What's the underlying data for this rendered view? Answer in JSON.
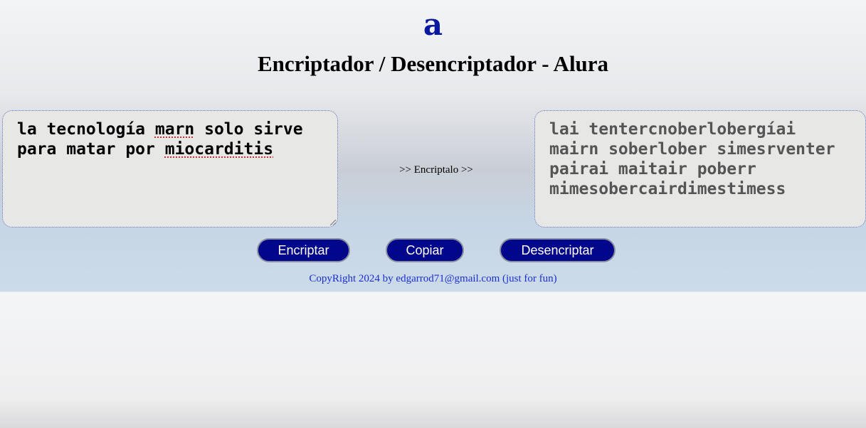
{
  "header": {
    "logo": "a",
    "title": "Encriptador / Desencriptador - Alura"
  },
  "input": {
    "text_line1_part1": "la tecnología ",
    "text_line1_misspelled": "marn",
    "text_line1_part2": " solo sirve",
    "text_line2_part1": "para matar por ",
    "text_line2_misspelled": "miocarditis"
  },
  "middle": {
    "label": ">> Encriptalo >>"
  },
  "output": {
    "text": "lai tentercnoberlobergíai\nmairn soberlober simesrventer\npairai maitair poberr\nmimesobercairdimestimess"
  },
  "buttons": {
    "encrypt": "Encriptar",
    "copy": "Copiar",
    "decrypt": "Desencriptar"
  },
  "footer": {
    "text": "CopyRight 2024 by edgarrod71@gmail.com (just for fun)"
  },
  "colors": {
    "logo": "#0a1a9e",
    "button_bg": "#02068a",
    "footer_text": "#1b2fd0"
  }
}
